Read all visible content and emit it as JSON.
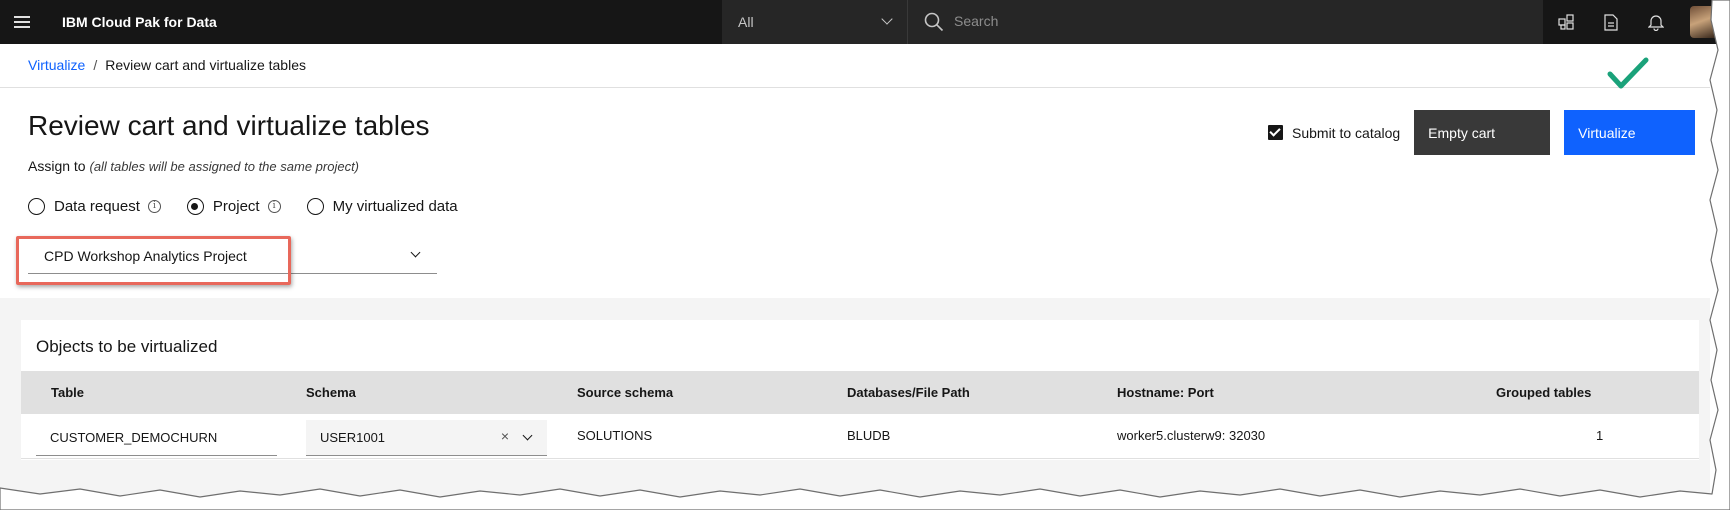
{
  "header": {
    "app_title": "IBM Cloud Pak for Data",
    "scope_value": "All",
    "search_placeholder": "Search",
    "icons": [
      "menu-icon",
      "apps-icon",
      "document-icon",
      "notification-icon",
      "avatar"
    ]
  },
  "breadcrumb": {
    "link": "Virtualize",
    "separator": "/",
    "current": "Review cart and virtualize tables"
  },
  "page": {
    "title": "Review cart and virtualize tables",
    "assign_label": "Assign to",
    "assign_note": "(all tables will be assigned to the same project)"
  },
  "assign_options": [
    {
      "label": "Data request",
      "checked": false,
      "info": true
    },
    {
      "label": "Project",
      "checked": true,
      "info": true
    },
    {
      "label": "My virtualized data",
      "checked": false,
      "info": false
    }
  ],
  "project_select": {
    "value": "CPD Workshop Analytics Project"
  },
  "actions": {
    "submit_to_catalog": "Submit to catalog",
    "submit_checked": true,
    "empty_cart": "Empty cart",
    "virtualize": "Virtualize"
  },
  "objects": {
    "title": "Objects to be virtualized",
    "columns": [
      "Table",
      "Schema",
      "Source schema",
      "Databases/File Path",
      "Hostname: Port",
      "Grouped tables"
    ],
    "rows": [
      {
        "table": "CUSTOMER_DEMOCHURN",
        "schema": "USER1001",
        "source_schema": "SOLUTIONS",
        "database": "BLUDB",
        "host_port": "worker5.clusterw9: 32030",
        "grouped_tables": "1"
      }
    ]
  },
  "colors": {
    "topbar": "#161616",
    "primary": "#0f62fe",
    "secondary": "#393939",
    "highlight": "#e8685b",
    "check": "#1aa27a"
  }
}
